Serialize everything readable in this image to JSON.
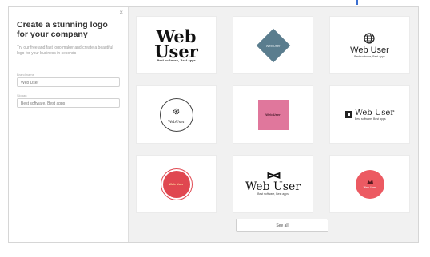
{
  "sidebar": {
    "close_glyph": "×",
    "title": "Create a stunning logo for your company",
    "description": "Try our free and fast logo maker and create a beautiful logo for your business in seconds",
    "fields": [
      {
        "label": "Brand name",
        "value": "Web User"
      },
      {
        "label": "Slogan",
        "value": "Best software, Best apps"
      }
    ]
  },
  "logos": [
    {
      "line1": "Web",
      "line2": "User",
      "tagline": "Best software, Best apps"
    },
    {
      "text": "Web User",
      "color": "#5a7d8e"
    },
    {
      "text": "Web User",
      "tagline": "Best software, Best apps",
      "icon": "globe-icon"
    },
    {
      "text": "WebUser",
      "icon": "gear-icon"
    },
    {
      "text": "Web User",
      "color": "#e0779c"
    },
    {
      "text": "Web User",
      "tagline": "Best software, Best apps",
      "icon": "square-icon"
    },
    {
      "text": "Web User",
      "color": "#e04750"
    },
    {
      "glyph": "ᐅᐊ",
      "text": "Web User",
      "tagline": "Best software, Best apps",
      "icon": "bowtie-icon"
    },
    {
      "text": "Web User",
      "color": "#ec5a62",
      "icon": "bird-icon"
    }
  ],
  "see_all_label": "See all",
  "colors": {
    "accent": "#3b6fd1",
    "frame_bg": "#f1f1f1"
  }
}
